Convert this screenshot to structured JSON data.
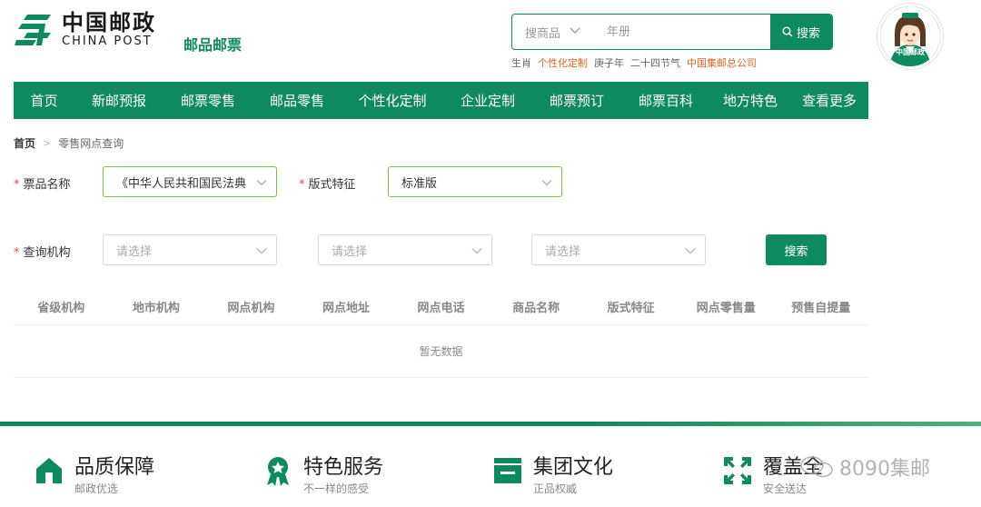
{
  "header": {
    "logo_cn": "中国邮政",
    "logo_en": "CHINA POST",
    "site_name": "邮品邮票",
    "search": {
      "category": "搜商品",
      "placeholder": "年册",
      "button": "搜索"
    },
    "hot_words": [
      "生肖",
      "个性化定制",
      "庚子年",
      "二十四节气",
      "中国集邮总公司"
    ],
    "mascot_label": "中国邮政"
  },
  "nav": {
    "items": [
      "首页",
      "新邮预报",
      "邮票零售",
      "邮品零售",
      "个性化定制",
      "企业定制",
      "邮票预订",
      "邮票百科",
      "地方特色",
      "查看更多"
    ]
  },
  "breadcrumb": {
    "home": "首页",
    "separator": ">",
    "current": "零售网点查询"
  },
  "form": {
    "stamp_name_label": "票品名称",
    "stamp_name_value": "《中华人民共和国民法典",
    "version_label": "版式特征",
    "version_value": "标准版",
    "org_label": "查询机构",
    "org_placeholder_1": "请选择",
    "org_placeholder_2": "请选择",
    "org_placeholder_3": "请选择",
    "search_button": "搜索",
    "required_mark": "*"
  },
  "table": {
    "columns": [
      "省级机构",
      "地市机构",
      "网点机构",
      "网点地址",
      "网点电话",
      "商品名称",
      "版式特征",
      "网点零售量",
      "预售自提量"
    ],
    "empty_text": "暂无数据"
  },
  "footer": {
    "features": [
      {
        "title": "品质保障",
        "sub": "邮政优选"
      },
      {
        "title": "特色服务",
        "sub": "不一样的感受"
      },
      {
        "title": "集团文化",
        "sub": "正品权威"
      },
      {
        "title": "覆盖全",
        "sub": "安全送达"
      }
    ],
    "watermark": "8090集邮"
  },
  "colors": {
    "brand_green": "#0e8a5f",
    "highlight_orange": "#e0641b",
    "required_red": "#e04848"
  }
}
